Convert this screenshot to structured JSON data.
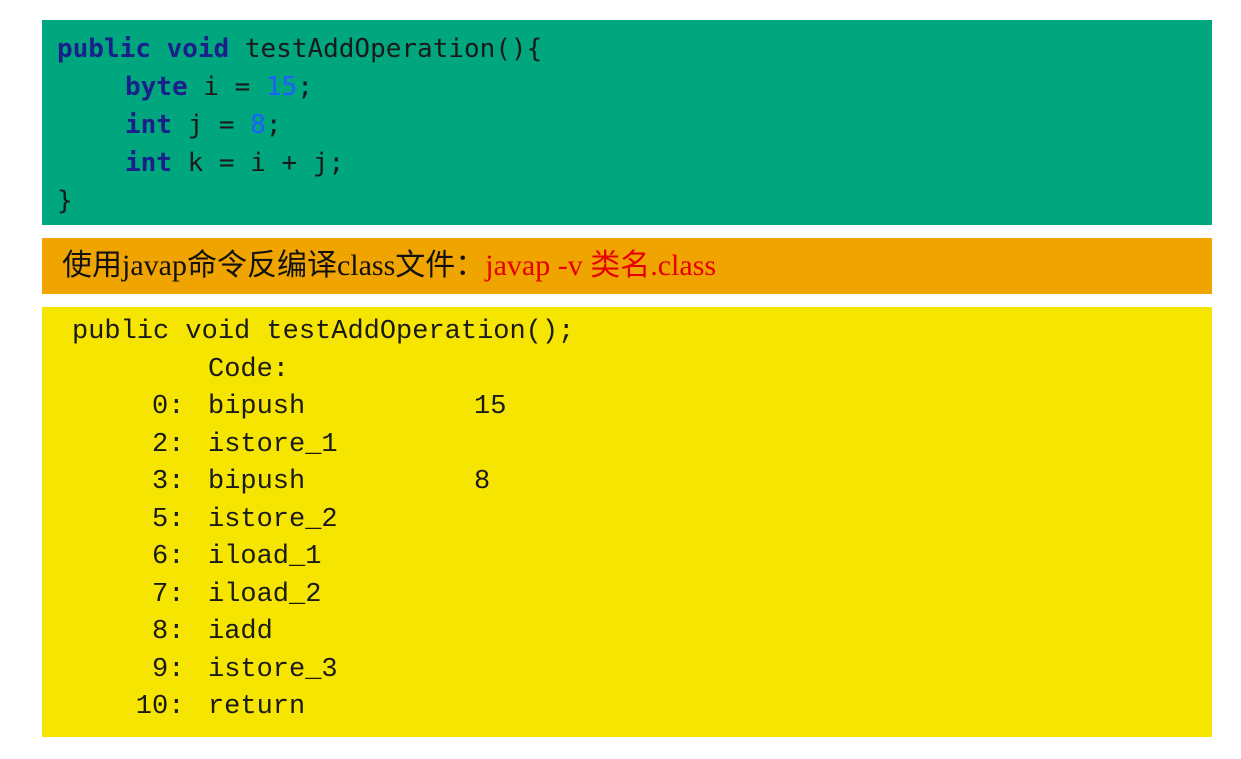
{
  "java_source": {
    "method_signature": {
      "modifier": "public",
      "return_type": "void",
      "name_and_brace": " testAddOperation(){"
    },
    "statements": [
      {
        "type": "byte",
        "mid": " i = ",
        "value": "15",
        "end": ";"
      },
      {
        "type": "int",
        "mid": " j = ",
        "value": "8",
        "end": ";"
      },
      {
        "type": "int",
        "mid": " k = i + j;",
        "value": "",
        "end": ""
      }
    ],
    "closing_brace": "}"
  },
  "banner": {
    "label": "使用javap命令反编译class文件：",
    "command": "javap -v 类名.class"
  },
  "bytecode": {
    "signature": "public void testAddOperation();",
    "code_header": "Code:",
    "instructions": [
      {
        "offset": "0:",
        "op": "bipush",
        "arg": "15"
      },
      {
        "offset": "2:",
        "op": "istore_1",
        "arg": ""
      },
      {
        "offset": "3:",
        "op": "bipush",
        "arg": "8"
      },
      {
        "offset": "5:",
        "op": "istore_2",
        "arg": ""
      },
      {
        "offset": "6:",
        "op": "iload_1",
        "arg": ""
      },
      {
        "offset": "7:",
        "op": "iload_2",
        "arg": ""
      },
      {
        "offset": "8:",
        "op": "iadd",
        "arg": ""
      },
      {
        "offset": "9:",
        "op": "istore_3",
        "arg": ""
      },
      {
        "offset": "10:",
        "op": "return",
        "arg": ""
      }
    ]
  },
  "colors": {
    "source_panel": "#00a77e",
    "banner": "#f0a400",
    "bytecode_panel": "#f6e500",
    "keyword": "#1b1f8a",
    "number": "#1f5fff",
    "command": "#e60000"
  }
}
